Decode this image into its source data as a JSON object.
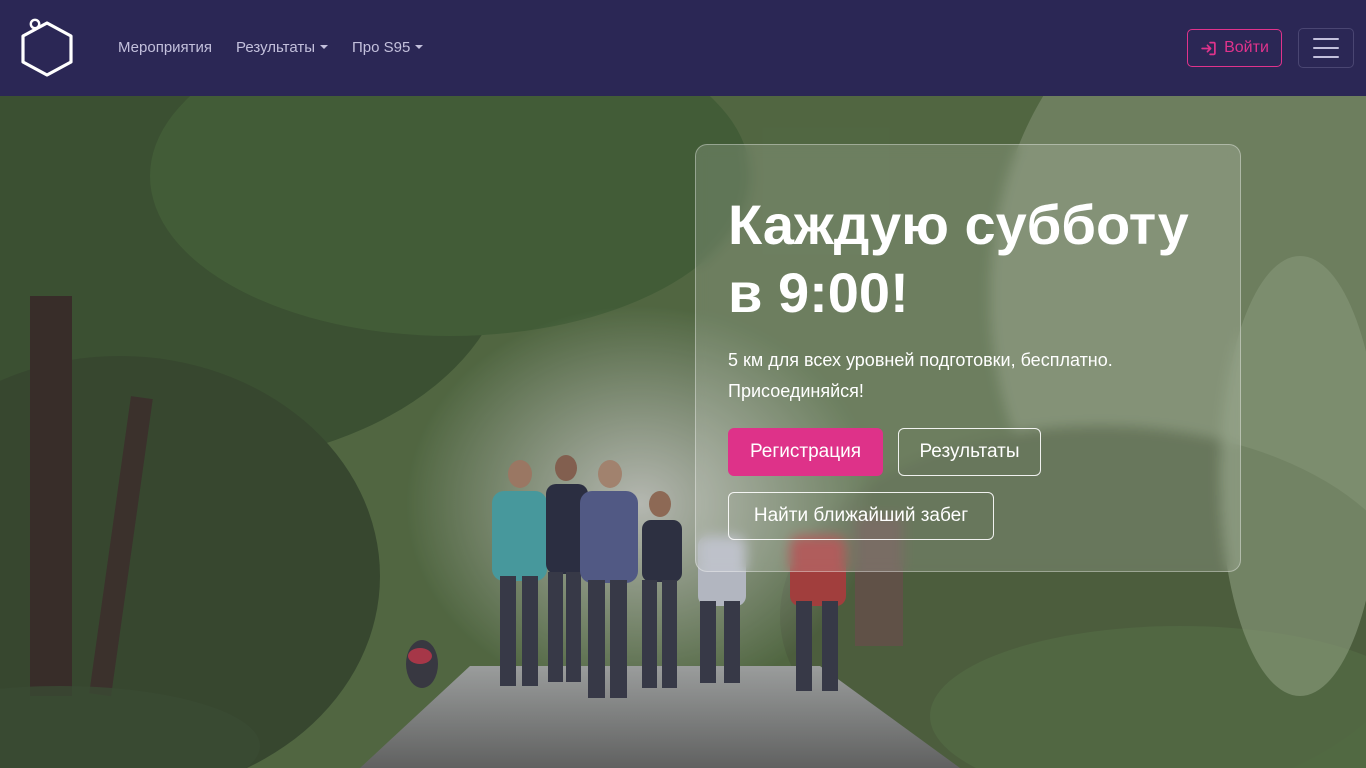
{
  "nav": {
    "events": "Мероприятия",
    "results": "Результаты",
    "about": "Про S95",
    "login": "Войти"
  },
  "hero": {
    "title_line1": "Каждую субботу",
    "title_line2": "в 9:00!",
    "description_line1": "5 км для всех уровней подготовки, бесплатно.",
    "description_line2": "Присоединяйся!",
    "register": "Регистрация",
    "results": "Результаты",
    "find_nearest": "Найти ближайший забег"
  },
  "colors": {
    "navbar_bg": "#2b2755",
    "accent": "#de3289",
    "nav_text": "#c3c0dc"
  },
  "icons": [
    "hexagon-logo-icon",
    "login-arrow-icon",
    "hamburger-menu-icon",
    "caret-down-icon"
  ]
}
